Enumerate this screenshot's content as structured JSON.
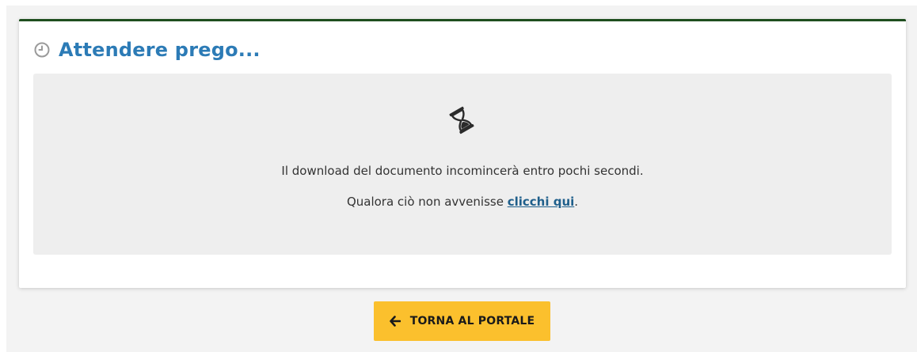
{
  "panel": {
    "title": "Attendere prego...",
    "title_icon": "clock-icon",
    "title_color": "#2c7bb6",
    "accent_border": "#1f4e1f"
  },
  "notice": {
    "icon": "hourglass-icon",
    "message": "Il download del documento incomincerà entro pochi secondi.",
    "fallback_prefix": "Qualora ciò non avvenisse ",
    "fallback_link": "clicchi qui",
    "fallback_suffix": ".",
    "background": "#eeeeee"
  },
  "actions": {
    "back_label": "TORNA AL PORTALE",
    "back_icon": "arrow-left-icon",
    "back_color": "#fbc02d"
  }
}
